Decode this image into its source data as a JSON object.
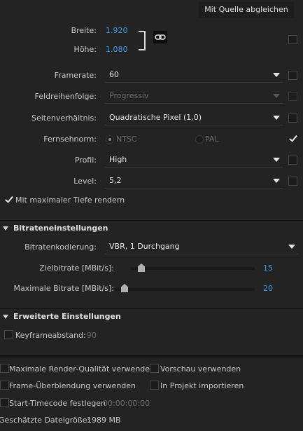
{
  "top": {
    "match_source_button": "Mit Quelle abgleichen"
  },
  "video": {
    "width_label": "Breite:",
    "width_value": "1.920",
    "height_label": "Höhe:",
    "height_value": "1.080",
    "framerate_label": "Framerate:",
    "framerate_value": "60",
    "field_order_label": "Feldreihenfolge:",
    "field_order_value": "Progressiv",
    "aspect_label": "Seitenverhältnis:",
    "aspect_value": "Quadratische Pixel (1,0)",
    "tv_standard_label": "Fernsehnorm:",
    "tv_ntsc": "NTSC",
    "tv_pal": "PAL",
    "profile_label": "Profil:",
    "profile_value": "High",
    "level_label": "Level:",
    "level_value": "5,2",
    "max_depth_label": "Mit maximaler Tiefe rendern"
  },
  "bitrate": {
    "section_title": "Bitrateneinstellungen",
    "encoding_label": "Bitratenkodierung:",
    "encoding_value": "VBR, 1 Durchgang",
    "target_label": "Zielbitrate [MBit/s]:",
    "target_value": "15",
    "target_level": 0.09,
    "max_label": "Maximale Bitrate [MBit/s]:",
    "max_value": "20",
    "max_level": 0.07
  },
  "advanced": {
    "section_title": "Erweiterte Einstellungen",
    "keyframe_label": "Keyframeabstand:",
    "keyframe_value": "90"
  },
  "footer": {
    "max_quality": "Maximale Render-Qualität verwenden",
    "use_preview": "Vorschau verwenden",
    "frame_blending": "Frame-Überblendung verwenden",
    "import_project": "In Projekt importieren",
    "start_timecode": "Start-Timecode festlegen",
    "timecode_value": "00:00:00:00",
    "file_size_label": "Geschätzte Dateigröße:",
    "file_size_value": "1989 MB"
  }
}
